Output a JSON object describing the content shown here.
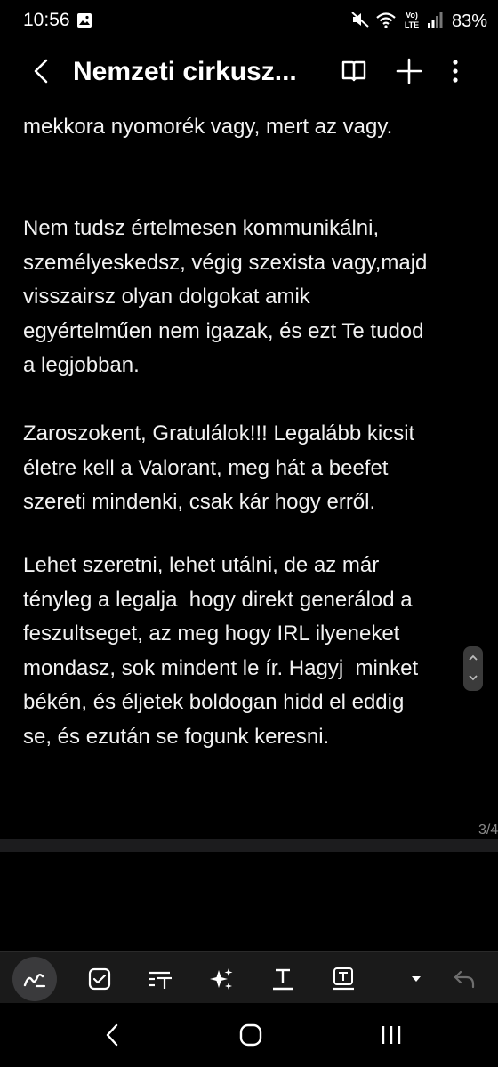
{
  "status_bar": {
    "time": "10:56",
    "battery": "83%",
    "icons": [
      "image-icon",
      "mute-icon",
      "wifi-icon",
      "volte-icon",
      "signal-icon"
    ]
  },
  "app_bar": {
    "title": "Nemzeti cirkusz...",
    "icons": [
      "back-icon",
      "reading-mode-icon",
      "add-icon",
      "more-icon"
    ]
  },
  "note": {
    "paragraphs": [
      "mekkora nyomorék vagy, mert az vagy.",
      "Nem tudsz értelmesen kommunikálni,\nszemélyeskedsz, végig szexista vagy,majd\nvisszairsz olyan dolgokat amik\negyértelműen nem igazak, és ezt Te tudod\na legjobban.",
      "Zaroszokent, Gratulálok!!! Legalább kicsit\néletre kell a Valorant, meg hát a beefet\nszereti mindenki, csak kár hogy erről.",
      "Lehet szeretni, lehet utálni, de az már\ntényleg a legalja  hogy direkt generálod a\nfeszultseget, az meg hogy IRL ilyeneket\nmondasz, sok mindent le ír. Hagyj  minket\nbékén, és éljetek boldogan hidd el eddig\nse, és ezután se fogunk keresni."
    ],
    "page_indicator": "3/4"
  },
  "toolbar": {
    "tools": [
      "pen-icon",
      "checkbox-icon",
      "text-style-icon",
      "ai-assist-icon",
      "text-underline-icon",
      "text-box-icon",
      "dropdown-icon",
      "undo-icon"
    ]
  },
  "navigation": {
    "buttons": [
      "recents-icon",
      "home-icon",
      "back-nav-icon"
    ]
  }
}
